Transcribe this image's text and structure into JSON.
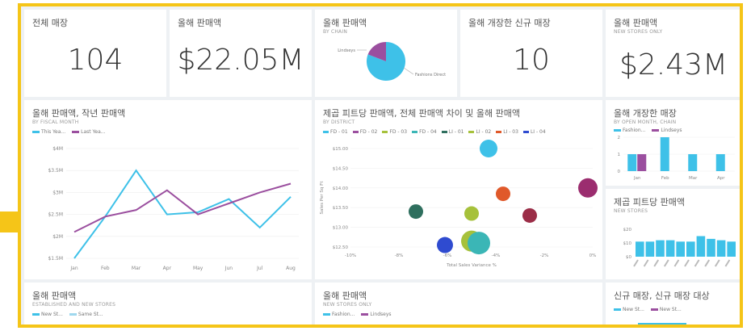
{
  "colors": {
    "frame": "#f5c518",
    "cyan": "#3ec1e8",
    "purple": "#9b4f9f",
    "arrow": "#f5c518"
  },
  "tiles": {
    "total_stores": {
      "title": "전체 매장",
      "value": "104"
    },
    "sales": {
      "title": "올해 판매액",
      "value": "$22.05M"
    },
    "sales_by_chain": {
      "title": "올해 판매액",
      "subtitle": "BY CHAIN",
      "label_a": "Lindseys",
      "label_b": "Fashions Direct"
    },
    "new_stores": {
      "title": "올해 개장한 신규 매장",
      "value": "10"
    },
    "new_sales": {
      "title": "올해 판매액",
      "subtitle": "NEW STORES ONLY",
      "value": "$2.43M"
    },
    "monthly": {
      "title": "올해 판매액, 작년 판매액",
      "subtitle": "BY FISCAL MONTH",
      "legend": [
        "This Yea...",
        "Last Yea..."
      ]
    },
    "district": {
      "title": "제곱 피트당 판매액, 전체 판매액 차이 및 올해 판매액",
      "subtitle": "BY DISTRICT",
      "legend": [
        "FD - 01",
        "FD - 02",
        "FD - 03",
        "FD - 04",
        "LI - 01",
        "LI - 02",
        "LI - 03",
        "LI - 04"
      ],
      "xlabel": "Total Sales Variance %",
      "ylabel": "Sales Per Sq Ft"
    },
    "open_month": {
      "title": "올해 개장한 매장",
      "subtitle": "BY OPEN MONTH, CHAIN",
      "legend": [
        "Fashion...",
        "Lindseys"
      ]
    },
    "sqft": {
      "title": "제곱 피트당 판매액",
      "subtitle": "NEW STORES"
    },
    "bottom1": {
      "title": "올해 판매액",
      "subtitle": "ESTABLISHED AND NEW STORES",
      "legend": [
        "New St...",
        "Same St..."
      ]
    },
    "bottom2": {
      "title": "올해 판매액",
      "subtitle": "NEW STORES ONLY",
      "legend": [
        "Fashion...",
        "Lindseys"
      ]
    },
    "bottom3": {
      "title": "신규 매장, 신규 매장 대상",
      "legend": [
        "New St...",
        "New St..."
      ]
    }
  },
  "chart_data": [
    {
      "type": "pie",
      "title": "올해 판매액",
      "categories": [
        "Fashions Direct",
        "Lindseys"
      ],
      "values": [
        0.78,
        0.22
      ]
    },
    {
      "type": "line",
      "title": "올해 판매액, 작년 판매액",
      "categories": [
        "Jan",
        "Feb",
        "Mar",
        "Apr",
        "May",
        "Jun",
        "Jul",
        "Aug"
      ],
      "yticks": [
        "$4M",
        "$3.5M",
        "$3M",
        "$2.5M",
        "$2M",
        "$1.5M"
      ],
      "ylim": [
        1.5,
        4
      ],
      "series": [
        {
          "name": "This Yea...",
          "values": [
            1.5,
            2.45,
            3.5,
            2.5,
            2.55,
            2.85,
            2.2,
            2.9
          ]
        },
        {
          "name": "Last Yea...",
          "values": [
            2.1,
            2.45,
            2.6,
            3.05,
            2.5,
            2.75,
            3.0,
            3.2
          ]
        }
      ]
    },
    {
      "type": "scatter",
      "title": "제곱 피트당 판매액, 전체 판매액 차이 및 올해 판매액",
      "xticks": [
        "-10%",
        "-8%",
        "-6%",
        "-4%",
        "-2%",
        "0%"
      ],
      "yticks": [
        "$15.00",
        "$14.50",
        "$14.00",
        "$13.50",
        "$13.00",
        "$12.50"
      ],
      "xlim": [
        -10,
        0
      ],
      "ylim": [
        12.5,
        15
      ],
      "xlabel": "Total Sales Variance %",
      "ylabel": "Sales Per Sq Ft",
      "points": [
        {
          "x": -4.3,
          "y": 15.0,
          "r": 11,
          "color": "#3ec1e8"
        },
        {
          "x": -0.2,
          "y": 14.0,
          "r": 12,
          "color": "#9b2d6f"
        },
        {
          "x": -3.7,
          "y": 13.85,
          "r": 9,
          "color": "#e0592a"
        },
        {
          "x": -7.3,
          "y": 13.4,
          "r": 9,
          "color": "#2f6f5e"
        },
        {
          "x": -5.0,
          "y": 13.35,
          "r": 9,
          "color": "#a6c13b"
        },
        {
          "x": -2.6,
          "y": 13.3,
          "r": 9,
          "color": "#9b2d47"
        },
        {
          "x": -5.0,
          "y": 12.65,
          "r": 13,
          "color": "#a6c13b"
        },
        {
          "x": -4.7,
          "y": 12.6,
          "r": 14,
          "color": "#3bb6b6"
        },
        {
          "x": -6.1,
          "y": 12.55,
          "r": 10,
          "color": "#2f4bd0"
        }
      ]
    },
    {
      "type": "bar",
      "title": "올해 개장한 매장",
      "categories": [
        "Jan",
        "Feb",
        "Mar",
        "Apr"
      ],
      "yticks": [
        "2",
        "1",
        "0"
      ],
      "series": [
        {
          "name": "Fashion...",
          "values": [
            1,
            2,
            1,
            1
          ]
        },
        {
          "name": "Lindseys",
          "values": [
            1,
            0,
            0,
            0
          ]
        }
      ]
    },
    {
      "type": "bar",
      "title": "제곱 피트당 판매액",
      "yticks": [
        "$20",
        "$10",
        "$0"
      ],
      "values": [
        11,
        11,
        12,
        12,
        11,
        11,
        15,
        13,
        12,
        11
      ]
    }
  ]
}
